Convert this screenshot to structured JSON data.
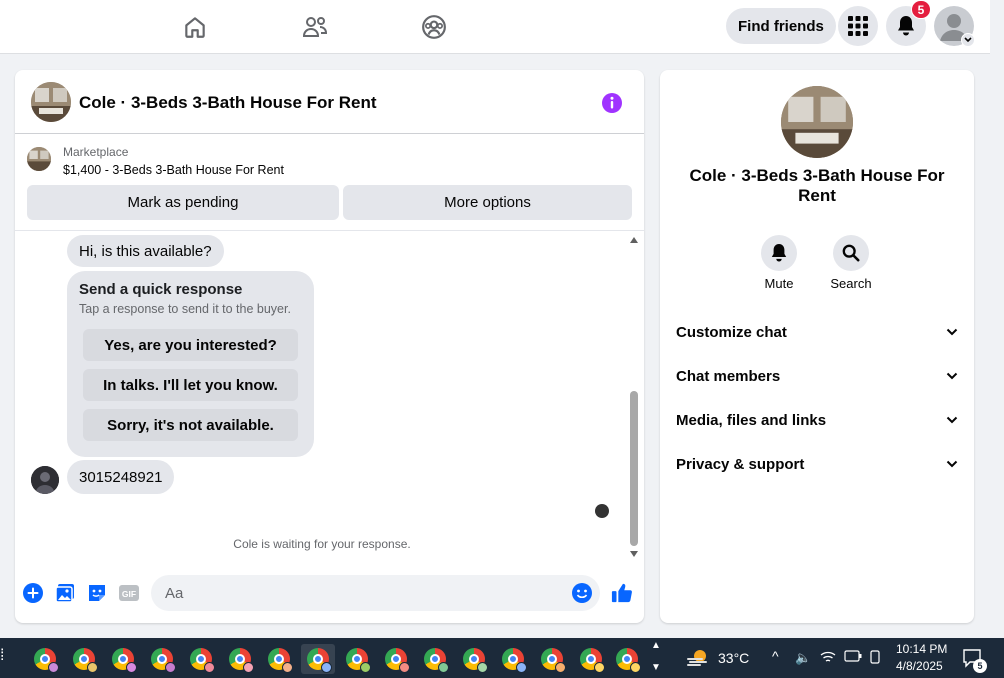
{
  "topbar": {
    "nav_icons": [
      "home-icon",
      "friends-icon",
      "groups-icon"
    ],
    "find_friends_label": "Find friends",
    "notification_count": "5"
  },
  "conversation": {
    "title": "Cole · 3-Beds 3-Bath House For Rent",
    "marketplace_label": "Marketplace",
    "listing": "$1,400 - 3-Beds 3-Bath House For Rent",
    "mark_pending_label": "Mark as pending",
    "more_options_label": "More options",
    "messages": {
      "first": "Hi, is this available?",
      "quick_response_title": "Send a quick response",
      "quick_response_subtitle": "Tap a response to send it to the buyer.",
      "quick_responses": [
        "Yes, are you interested?",
        "In talks. I'll let you know.",
        "Sorry, it's not available."
      ],
      "phone": "3015248921"
    },
    "waiting_text": "Cole is waiting for your response.",
    "composer_placeholder": "Aa"
  },
  "info_panel": {
    "title": "Cole · 3-Beds 3-Bath House For Rent",
    "mute_label": "Mute",
    "search_label": "Search",
    "sections": [
      "Customize chat",
      "Chat members",
      "Media, files and links",
      "Privacy & support"
    ]
  },
  "taskbar": {
    "app_count_note": "chrome",
    "temperature": "33°C",
    "time": "10:14 PM",
    "date": "4/8/2025",
    "notification_count": "5"
  },
  "colors": {
    "accent_blue": "#0866ff",
    "info_purple": "#a033ff",
    "badge_red": "#e41e3f"
  }
}
